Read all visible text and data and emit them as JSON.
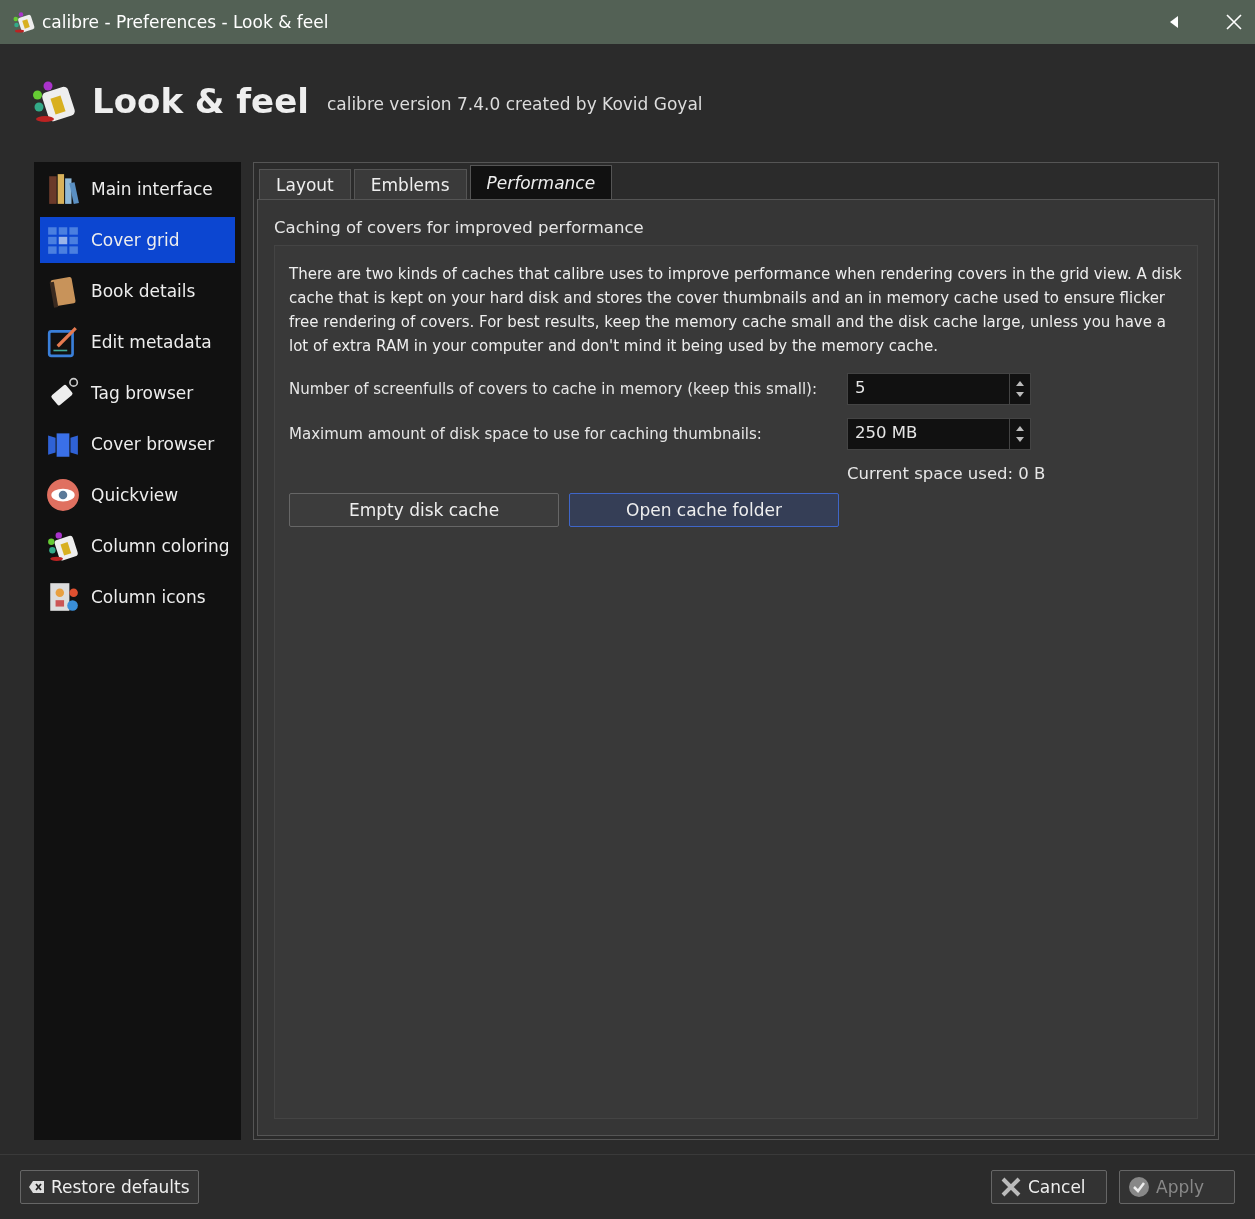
{
  "window": {
    "title": "calibre - Preferences - Look & feel"
  },
  "header": {
    "title": "Look & feel",
    "subtitle": "calibre version 7.4.0 created by Kovid Goyal"
  },
  "sidebar": {
    "items": [
      {
        "label": "Main interface",
        "selected": false
      },
      {
        "label": "Cover grid",
        "selected": true
      },
      {
        "label": "Book details",
        "selected": false
      },
      {
        "label": "Edit metadata",
        "selected": false
      },
      {
        "label": "Tag browser",
        "selected": false
      },
      {
        "label": "Cover browser",
        "selected": false
      },
      {
        "label": "Quickview",
        "selected": false
      },
      {
        "label": "Column coloring",
        "selected": false
      },
      {
        "label": "Column icons",
        "selected": false
      }
    ]
  },
  "tabs": [
    {
      "label": "Layout",
      "selected": false
    },
    {
      "label": "Emblems",
      "selected": false
    },
    {
      "label": "Performance",
      "selected": true
    }
  ],
  "section": {
    "title": "Caching of covers for improved performance",
    "description": "There are two kinds of caches that calibre uses to improve performance when rendering covers in the grid view. A disk cache that is kept on your hard disk and stores the cover thumbnails and an in memory cache used to ensure flicker free rendering of covers. For best results, keep the memory cache small and the disk cache large, unless you have a lot of extra RAM in your computer and don't mind it being used by the memory cache.",
    "fields": [
      {
        "label": "Number of screenfulls of covers to cache in memory (keep this small):",
        "value": "5"
      },
      {
        "label": "Maximum amount of disk space to use for caching thumbnails:",
        "value": "250 MB"
      }
    ],
    "space_used": "Current space used: 0 B",
    "buttons": [
      {
        "label": "Empty disk cache",
        "focused": false
      },
      {
        "label": "Open cache folder",
        "focused": true
      }
    ]
  },
  "footer": {
    "restore": "Restore defaults",
    "cancel": "Cancel",
    "apply": {
      "label": "Apply",
      "disabled": true
    }
  }
}
